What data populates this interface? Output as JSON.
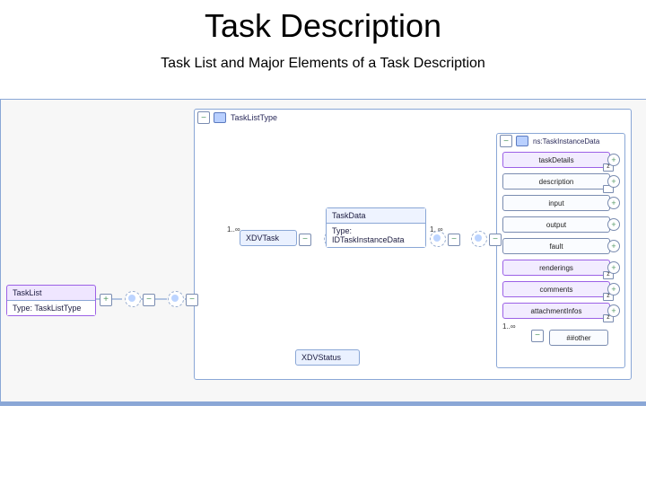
{
  "title": "Task Description",
  "subtitle": "Task List and Major Elements of a Task Description",
  "container": {
    "collapse_glyph": "−",
    "label": "TaskListType"
  },
  "attrPanel": {
    "collapse_glyph": "−",
    "label": "ns:TaskInstanceData"
  },
  "attributes": [
    {
      "label": "taskDetails",
      "selected": true,
      "corner": "z",
      "port": "+"
    },
    {
      "label": "description",
      "selected": false,
      "corner": "",
      "port": "+"
    },
    {
      "label": "input",
      "selected": false,
      "corner": "",
      "port": "+"
    },
    {
      "label": "output",
      "selected": false,
      "corner": "",
      "port": "+"
    },
    {
      "label": "fault",
      "selected": false,
      "corner": "",
      "port": "+"
    },
    {
      "label": "renderings",
      "selected": true,
      "corner": "z",
      "port": "+"
    },
    {
      "label": "comments",
      "selected": true,
      "corner": "z",
      "port": "+"
    },
    {
      "label": "attachmentInfos",
      "selected": true,
      "corner": "z",
      "port": "+"
    }
  ],
  "extraSeq": {
    "card": "1..∞",
    "collapse_glyph": "−",
    "label": "##other"
  },
  "taskList": {
    "name": "TaskList",
    "type": "Type: TaskListType"
  },
  "taskData": {
    "name": "TaskData",
    "type": "Type: IDTaskInstanceData"
  },
  "xdvTask": {
    "name": "XDVTask"
  },
  "xdvStatus": {
    "name": "XDVStatus"
  },
  "cards": {
    "beforeTask": "1..∞",
    "beforeChoice": "1..∞"
  },
  "ports": {
    "plus": "+",
    "minus": "−"
  }
}
